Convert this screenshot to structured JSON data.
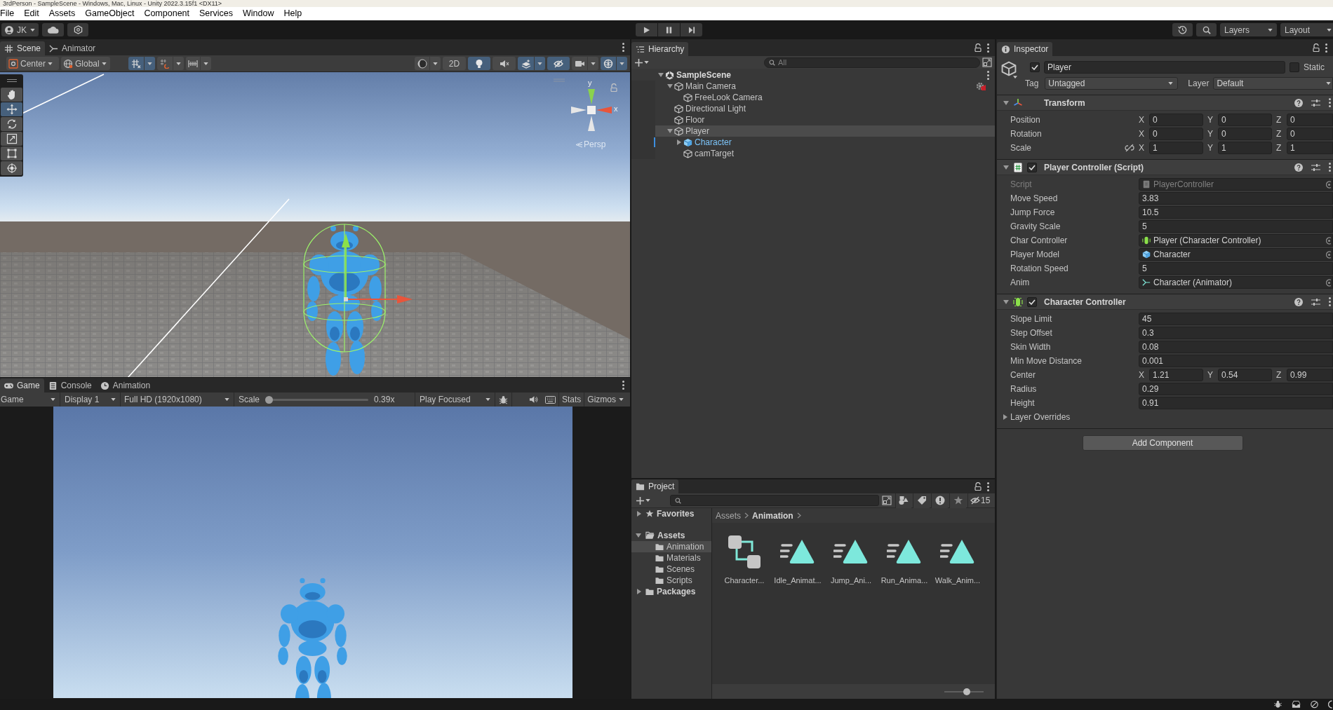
{
  "window": {
    "title": "3rdPerson - SampleScene - Windows, Mac, Linux - Unity 2022.3.15f1 <DX11>"
  },
  "menu_bar": [
    "File",
    "Edit",
    "Assets",
    "GameObject",
    "Component",
    "Services",
    "Window",
    "Help"
  ],
  "main_toolbar": {
    "account": "JK",
    "layers": "Layers",
    "layout": "Layout"
  },
  "scene_panel": {
    "tabs": [
      {
        "label": "Scene",
        "kind": "scene",
        "selected": true
      },
      {
        "label": "Animator",
        "kind": "animator",
        "selected": false
      }
    ],
    "toolbar": {
      "pivot": "Center",
      "space": "Global",
      "left_toggles": [
        {
          "kind": "grid_snap",
          "on": true
        },
        {
          "kind": "increment_snap",
          "on": false
        },
        {
          "kind": "grid",
          "on": false
        }
      ],
      "right_toggles": [
        {
          "kind": "shading",
          "on": false
        },
        {
          "kind": "mode_2d",
          "label": "2D",
          "on": false
        },
        {
          "kind": "lighting",
          "on": true
        },
        {
          "kind": "audio",
          "on": false
        },
        {
          "kind": "effects",
          "on": true
        },
        {
          "kind": "hidden",
          "on": true
        },
        {
          "kind": "camera",
          "on": false
        },
        {
          "kind": "gizmos",
          "on": true
        }
      ]
    },
    "tools": [
      {
        "kind": "hand",
        "selected": false
      },
      {
        "kind": "move",
        "selected": true
      },
      {
        "kind": "rotate",
        "selected": false
      },
      {
        "kind": "scale",
        "selected": false
      },
      {
        "kind": "rect",
        "selected": false
      },
      {
        "kind": "transform",
        "selected": false
      }
    ],
    "view_gizmo": {
      "y_axis": "y",
      "x_axis": "x",
      "projection": "Persp"
    }
  },
  "game_panel": {
    "tabs": [
      {
        "label": "Game",
        "kind": "game",
        "selected": true
      },
      {
        "label": "Console",
        "kind": "console",
        "selected": false
      },
      {
        "label": "Animation",
        "kind": "animation",
        "selected": false
      }
    ],
    "toolbar": {
      "view": "Game",
      "display": "Display 1",
      "resolution": "Full HD (1920x1080)",
      "scale_label": "Scale",
      "scale": {
        "level": 0
      },
      "scale_reading": "0.39x",
      "play_mode": "Play Focused",
      "stats": "Stats",
      "gizmos": "Gizmos"
    }
  },
  "hierarchy": {
    "tab": "Hierarchy",
    "search": {
      "placeholder": "All"
    },
    "items": [
      {
        "label": "SampleScene",
        "kind": "scene",
        "expanded": true,
        "selected": false,
        "children": [
          {
            "label": "Main Camera",
            "kind": "camera",
            "expanded": true,
            "selected": false,
            "children": [
              {
                "label": "FreeLook Camera",
                "kind": "object",
                "selected": false
              }
            ]
          },
          {
            "label": "Directional Light",
            "kind": "object",
            "selected": false
          },
          {
            "label": "Floor",
            "kind": "object",
            "selected": false
          },
          {
            "label": "Player",
            "kind": "object",
            "expanded": true,
            "selected": true,
            "children": [
              {
                "label": "Character",
                "kind": "prefab",
                "expanded": false,
                "selected": false
              },
              {
                "label": "camTarget",
                "kind": "object",
                "selected": false
              }
            ]
          }
        ]
      }
    ]
  },
  "project": {
    "tab": "Project",
    "filter_count": "15",
    "tree": [
      {
        "label": "Favorites",
        "kind": "favorites",
        "expanded": false,
        "selected": false
      },
      {
        "label": "Assets",
        "kind": "folder",
        "expanded": true,
        "selected": false,
        "children": [
          {
            "label": "Animation",
            "kind": "folder",
            "selected": true
          },
          {
            "label": "Materials",
            "kind": "folder",
            "selected": false
          },
          {
            "label": "Scenes",
            "kind": "folder",
            "selected": false
          },
          {
            "label": "Scripts",
            "kind": "folder",
            "selected": false
          }
        ]
      },
      {
        "label": "Packages",
        "kind": "folder",
        "expanded": false,
        "selected": false
      }
    ],
    "breadcrumb": [
      {
        "label": "Assets",
        "selected": false
      },
      {
        "label": "Animation",
        "selected": true
      }
    ],
    "assets": [
      {
        "label": "Character...",
        "kind": "controller"
      },
      {
        "label": "Idle_Animat...",
        "kind": "clip"
      },
      {
        "label": "Jump_Ani...",
        "kind": "clip"
      },
      {
        "label": "Run_Anima...",
        "kind": "clip"
      },
      {
        "label": "Walk_Anim...",
        "kind": "clip"
      }
    ],
    "icon_size": {
      "level": 0.59
    }
  },
  "inspector": {
    "tab": "Inspector",
    "object": {
      "active": true,
      "name": "Player",
      "static": false,
      "static_label": "Static",
      "tag_label": "Tag",
      "tag": "Untagged",
      "layer_label": "Layer",
      "layer": "Default"
    },
    "components": [
      {
        "kind": "transform",
        "title": "Transform",
        "expanded": true,
        "rows": [
          {
            "kind": "vector3",
            "label": "Position",
            "disabled": false,
            "values": [
              {
                "axis": "X",
                "value": "0"
              },
              {
                "axis": "Y",
                "value": "0"
              },
              {
                "axis": "Z",
                "value": "0"
              }
            ]
          },
          {
            "kind": "vector3",
            "label": "Rotation",
            "disabled": false,
            "values": [
              {
                "axis": "X",
                "value": "0"
              },
              {
                "axis": "Y",
                "value": "0"
              },
              {
                "axis": "Z",
                "value": "0"
              }
            ]
          },
          {
            "kind": "vector3",
            "label": "Scale",
            "disabled": false,
            "constrained": false,
            "values": [
              {
                "axis": "X",
                "value": "1"
              },
              {
                "axis": "Y",
                "value": "1"
              },
              {
                "axis": "Z",
                "value": "1"
              }
            ]
          }
        ]
      },
      {
        "kind": "script",
        "title": "Player Controller (Script)",
        "enabled": true,
        "expanded": true,
        "rows": [
          {
            "kind": "object_script",
            "label": "Script",
            "value": "PlayerController",
            "disabled": true
          },
          {
            "kind": "value",
            "label": "Move Speed",
            "value": "3.83",
            "disabled": false
          },
          {
            "kind": "value",
            "label": "Jump Force",
            "value": "10.5",
            "disabled": false
          },
          {
            "kind": "value",
            "label": "Gravity Scale",
            "value": "5",
            "disabled": false
          },
          {
            "kind": "object_controller",
            "label": "Char Controller",
            "value": "Player (Character Controller)",
            "disabled": false
          },
          {
            "kind": "object_prefab",
            "label": "Player Model",
            "value": "Character",
            "disabled": false
          },
          {
            "kind": "value",
            "label": "Rotation Speed",
            "value": "5",
            "disabled": false
          },
          {
            "kind": "object_animator",
            "label": "Anim",
            "value": "Character (Animator)",
            "disabled": false
          }
        ]
      },
      {
        "kind": "character_controller",
        "title": "Character Controller",
        "enabled": true,
        "expanded": true,
        "rows": [
          {
            "kind": "value",
            "label": "Slope Limit",
            "value": "45",
            "disabled": false
          },
          {
            "kind": "value",
            "label": "Step Offset",
            "value": "0.3",
            "disabled": false
          },
          {
            "kind": "value",
            "label": "Skin Width",
            "value": "0.08",
            "disabled": false
          },
          {
            "kind": "value",
            "label": "Min Move Distance",
            "value": "0.001",
            "disabled": false
          },
          {
            "kind": "vector3",
            "label": "Center",
            "disabled": false,
            "values": [
              {
                "axis": "X",
                "value": "1.21"
              },
              {
                "axis": "Y",
                "value": "0.54"
              },
              {
                "axis": "Z",
                "value": "0.99"
              }
            ]
          },
          {
            "kind": "value",
            "label": "Radius",
            "value": "0.29",
            "disabled": false
          },
          {
            "kind": "value",
            "label": "Height",
            "value": "0.91",
            "disabled": false
          },
          {
            "kind": "foldout",
            "label": "Layer Overrides",
            "expanded": false,
            "disabled": false
          }
        ]
      }
    ],
    "add_component": "Add Component"
  }
}
